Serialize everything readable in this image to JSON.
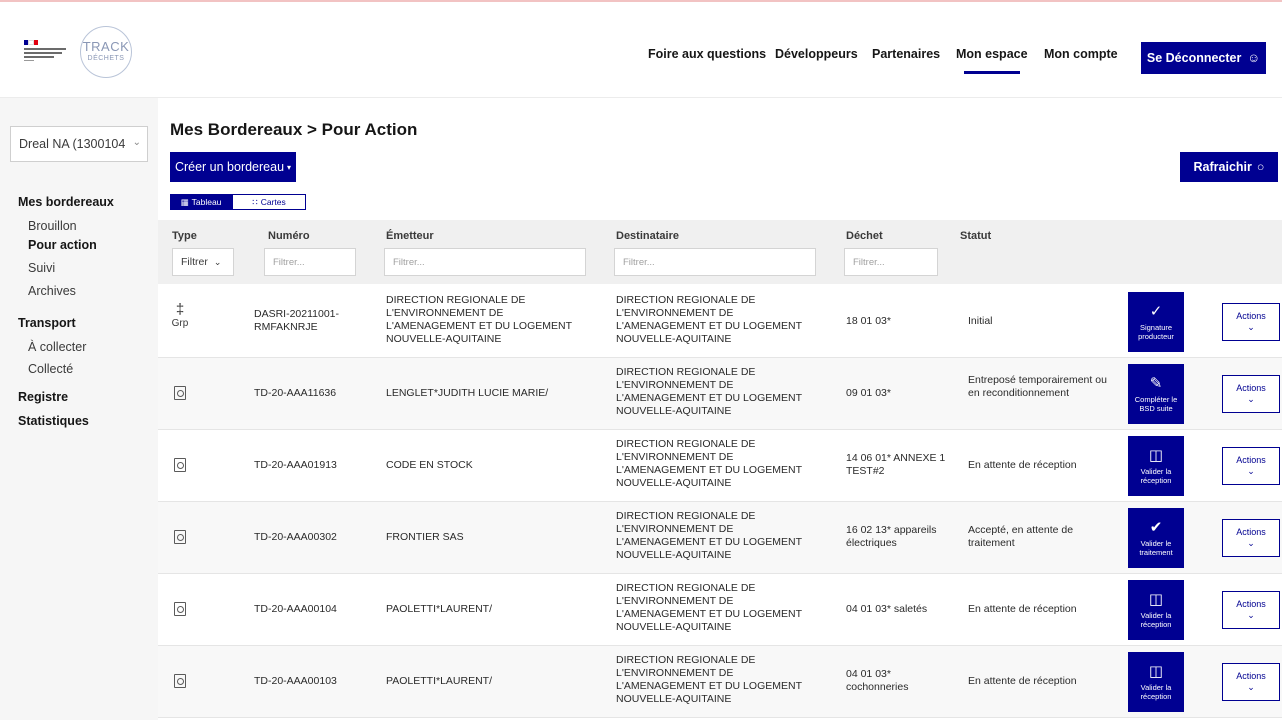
{
  "header": {
    "logo_text": "TRACK",
    "logo_subtext": "DÉCHETS",
    "nav": [
      {
        "label": "Foire aux questions"
      },
      {
        "label": "Développeurs"
      },
      {
        "label": "Partenaires"
      },
      {
        "label": "Mon espace"
      },
      {
        "label": "Mon compte"
      }
    ],
    "logout_label": "Se Déconnecter"
  },
  "sidebar": {
    "org_select": "Dreal NA (1300104",
    "sections": [
      {
        "title": "Mes bordereaux",
        "items": [
          "Brouillon",
          "Pour action",
          "Suivi",
          "Archives"
        ]
      },
      {
        "title": "Transport",
        "items": [
          "À collecter",
          "Collecté"
        ]
      },
      {
        "title": "Registre",
        "items": []
      },
      {
        "title": "Statistiques",
        "items": []
      }
    ]
  },
  "main": {
    "title": "Mes Bordereaux > Pour Action",
    "create_label": "Créer un bordereau",
    "refresh_label": "Rafraichir",
    "tabs": [
      {
        "label": "Tableau"
      },
      {
        "label": "Cartes"
      }
    ],
    "columns": [
      "Type",
      "Numéro",
      "Émetteur",
      "Destinataire",
      "Déchet",
      "Statut"
    ],
    "filters": {
      "type": "Filtrer",
      "numero": "Filtrer...",
      "emetteur": "Filtrer...",
      "destinataire": "Filtrer...",
      "dechet": "Filtrer..."
    },
    "actions_label": "Actions",
    "rows": [
      {
        "type": "Grp",
        "numero": "DASRI-20211001-RMFAKNRJE",
        "emetteur": "DIRECTION REGIONALE DE L'ENVIRONNEMENT DE L'AMENAGEMENT ET DU LOGEMENT NOUVELLE-AQUITAINE",
        "destinataire": "DIRECTION REGIONALE DE L'ENVIRONNEMENT DE L'AMENAGEMENT ET DU LOGEMENT NOUVELLE-AQUITAINE",
        "dechet": "18 01 03*",
        "statut": "Initial",
        "action": "Signature producteur"
      },
      {
        "type": "",
        "numero": "TD-20-AAA11636",
        "emetteur": "LENGLET*JUDITH LUCIE MARIE/",
        "destinataire": "DIRECTION REGIONALE DE L'ENVIRONNEMENT DE L'AMENAGEMENT ET DU LOGEMENT NOUVELLE-AQUITAINE",
        "dechet": "09 01 03*",
        "statut": "Entreposé temporairement ou en reconditionnement",
        "action": "Compléter le BSD suite"
      },
      {
        "type": "",
        "numero": "TD-20-AAA01913",
        "emetteur": "CODE EN STOCK",
        "destinataire": "DIRECTION REGIONALE DE L'ENVIRONNEMENT DE L'AMENAGEMENT ET DU LOGEMENT NOUVELLE-AQUITAINE",
        "dechet": "14 06 01* ANNEXE 1 TEST#2",
        "statut": "En attente de réception",
        "action": "Valider la réception"
      },
      {
        "type": "",
        "numero": "TD-20-AAA00302",
        "emetteur": "FRONTIER SAS",
        "destinataire": "DIRECTION REGIONALE DE L'ENVIRONNEMENT DE L'AMENAGEMENT ET DU LOGEMENT NOUVELLE-AQUITAINE",
        "dechet": "16 02 13* appareils électriques",
        "statut": "Accepté, en attente de traitement",
        "action": "Valider le traitement"
      },
      {
        "type": "",
        "numero": "TD-20-AAA00104",
        "emetteur": "PAOLETTI*LAURENT/",
        "destinataire": "DIRECTION REGIONALE DE L'ENVIRONNEMENT DE L'AMENAGEMENT ET DU LOGEMENT NOUVELLE-AQUITAINE",
        "dechet": "04 01 03* saletés",
        "statut": "En attente de réception",
        "action": "Valider la réception"
      },
      {
        "type": "",
        "numero": "TD-20-AAA00103",
        "emetteur": "PAOLETTI*LAURENT/",
        "destinataire": "DIRECTION REGIONALE DE L'ENVIRONNEMENT DE L'AMENAGEMENT ET DU LOGEMENT NOUVELLE-AQUITAINE",
        "dechet": "04 01 03* cochonneries",
        "statut": "En attente de réception",
        "action": "Valider la réception"
      }
    ]
  }
}
